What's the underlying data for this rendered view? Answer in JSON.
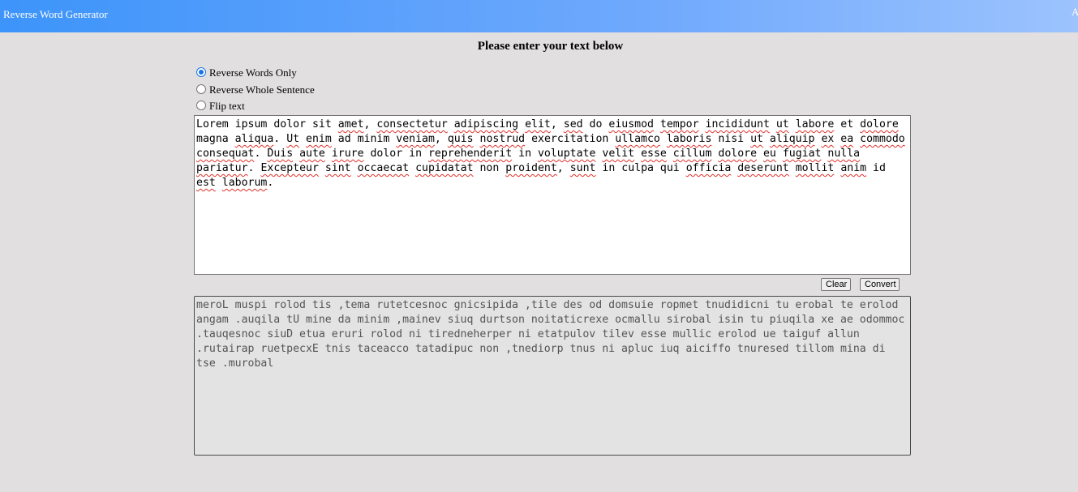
{
  "header": {
    "app_title": "Reverse Word Generator",
    "right_text": "A"
  },
  "main": {
    "heading": "Please enter your text below",
    "options": [
      {
        "label": "Reverse Words Only",
        "selected": true
      },
      {
        "label": "Reverse Whole Sentence",
        "selected": false
      },
      {
        "label": "Flip text",
        "selected": false
      }
    ],
    "input_text": "Lorem ipsum dolor sit amet, consectetur adipiscing elit, sed do eiusmod tempor incididunt ut labore et dolore magna aliqua. Ut enim ad minim veniam, quis nostrud exercitation ullamco laboris nisi ut aliquip ex ea commodo consequat. Duis aute irure dolor in reprehenderit in voluptate velit esse cillum dolore eu fugiat nulla pariatur. Excepteur sint occaecat cupidatat non proident, sunt in culpa qui officia deserunt mollit anim id est laborum.",
    "output_text": "meroL muspi rolod tis ,tema rutetcesnoc gnicsipida ,tile des od domsuie ropmet tnudidicni tu erobal te erolod angam .auqila tU mine da minim ,mainev siuq durtson noitaticrexe ocmallu sirobal isin tu piuqila xe ae odommoc .tauqesnoc siuD etua eruri rolod ni tiredneherper ni etatpulov tilev esse mullic erolod ue taiguf allun .rutairap ruetpecxE tnis taceacco tatadipuc non ,tnediorp tnus ni apluc iuq aiciffo tnuresed tillom mina di tse .murobal",
    "clear_label": "Clear",
    "convert_label": "Convert"
  },
  "colors": {
    "header_start": "#3d94fa",
    "header_end": "#9cc3fd",
    "background": "#e1dfe0",
    "radio_selected": "#1a73e8",
    "spellcheck": "#e0312b"
  }
}
